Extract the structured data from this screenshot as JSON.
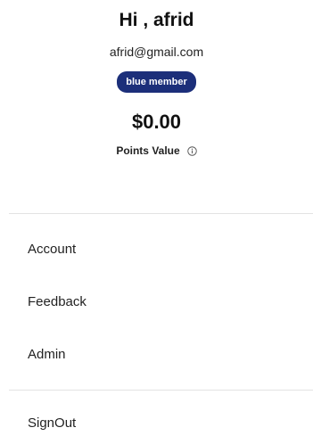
{
  "profile": {
    "greeting": "Hi , afrid",
    "email": "afrid@gmail.com",
    "membership_badge": "blue member"
  },
  "points": {
    "amount": "$0.00",
    "label": "Points Value",
    "info_icon": "info-circle-icon"
  },
  "menu": {
    "items": [
      {
        "label": "Account"
      },
      {
        "label": "Feedback"
      },
      {
        "label": "Admin"
      }
    ],
    "signout": {
      "label": "SignOut"
    }
  }
}
